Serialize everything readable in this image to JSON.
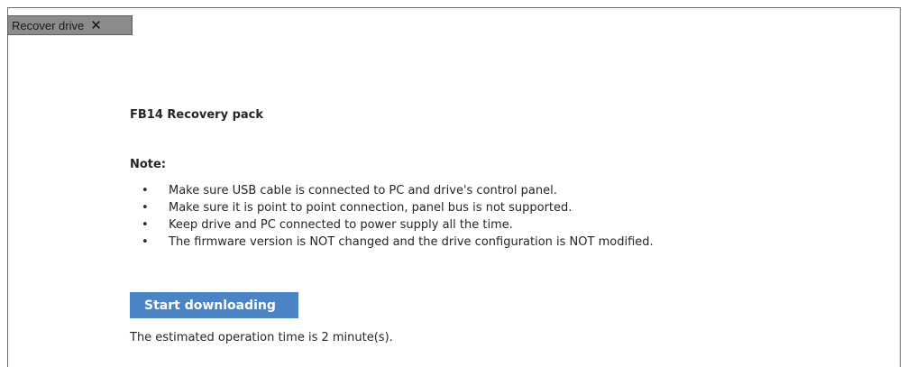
{
  "tab": {
    "label": "Recover drive",
    "close_glyph": "✕"
  },
  "main": {
    "title": "FB14 Recovery pack",
    "note_label": "Note:",
    "bullet_glyph": "•",
    "notes": [
      "Make sure USB cable is connected to PC and drive's control panel.",
      "Make sure it is point to point connection, panel bus is not supported.",
      "Keep drive and PC connected to power supply all the time.",
      "The firmware version is NOT changed and the drive configuration is NOT modified."
    ],
    "start_button_label": "Start downloading",
    "estimate_text": "The estimated operation time is 2 minute(s)."
  },
  "colors": {
    "tab_bg": "#8b8b8b",
    "button_bg": "#4a84c4",
    "button_text": "#ffffff",
    "text": "#262626"
  },
  "icons": {
    "tab_close": "close-icon"
  }
}
